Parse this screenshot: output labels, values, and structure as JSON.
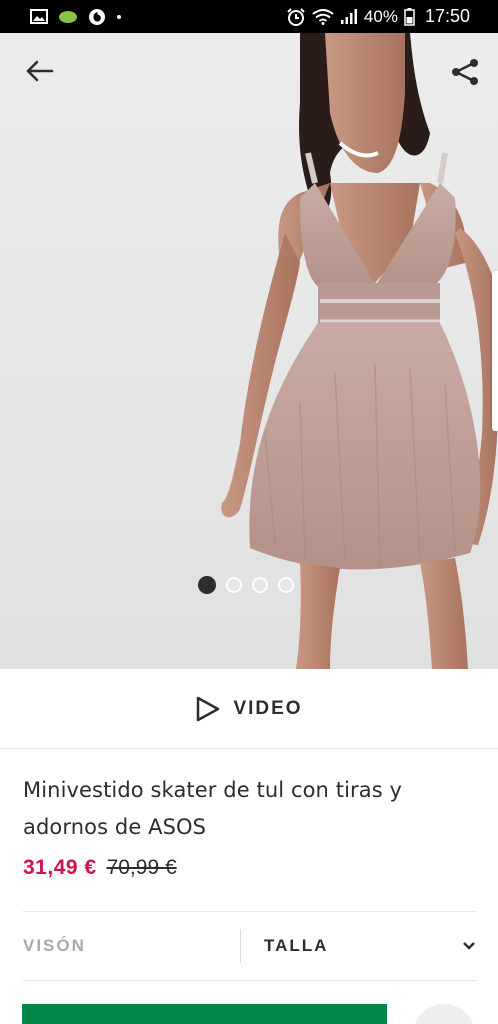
{
  "status_bar": {
    "battery_percent": "40%",
    "time": "17:50",
    "left_icons": [
      "gallery-icon",
      "green-leaf-icon",
      "vodafone-icon",
      "dot"
    ],
    "right_icons": [
      "alarm-icon",
      "wifi-icon",
      "signal-icon",
      "battery-icon"
    ]
  },
  "hero": {
    "image_count": 4,
    "active_index": 0,
    "back_icon": "arrow-left-icon",
    "share_icon": "share-icon"
  },
  "video": {
    "label": "VIDEO",
    "icon": "play-outline-icon"
  },
  "product": {
    "title_line1": "Minivestido skater de tul con tiras y",
    "title_line2": "adornos de ASOS",
    "price_current": "31,49 €",
    "price_old": "70,99 €"
  },
  "options": {
    "colour": "VISÓN",
    "size_label": "TALLA",
    "size_icon": "chevron-down-icon"
  },
  "colors": {
    "accent_price": "#d01345",
    "add_button": "#018849",
    "text": "#2d2d2d",
    "muted": "#a9a9a9"
  }
}
